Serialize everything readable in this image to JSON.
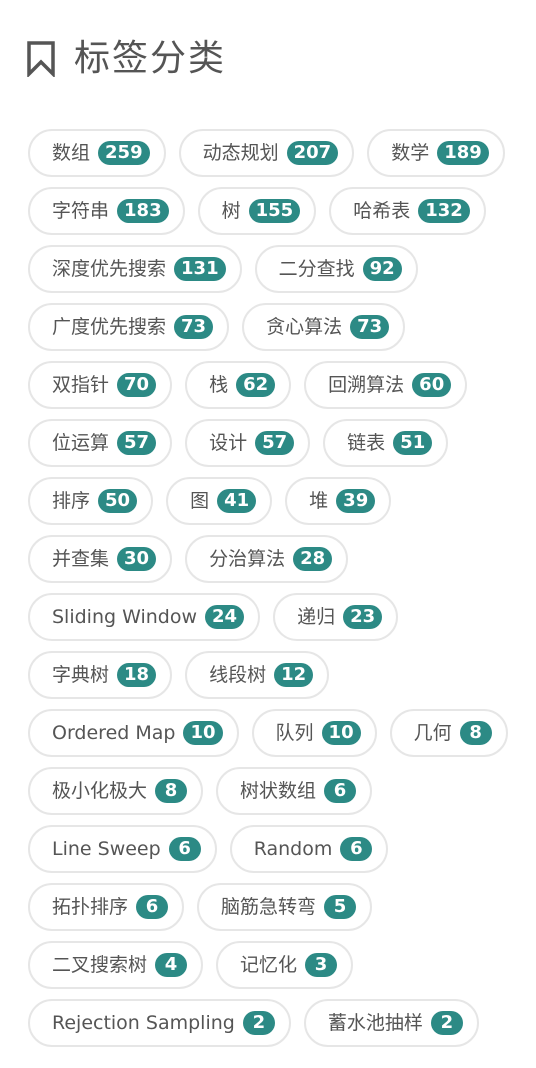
{
  "header": {
    "title": "标签分类",
    "icon": "bookmark-icon"
  },
  "colors": {
    "badge": "#2c8a85",
    "text": "#555555",
    "border": "#e6e6e6"
  },
  "tags": [
    {
      "label": "数组",
      "count": "259"
    },
    {
      "label": "动态规划",
      "count": "207"
    },
    {
      "label": "数学",
      "count": "189"
    },
    {
      "label": "字符串",
      "count": "183"
    },
    {
      "label": "树",
      "count": "155"
    },
    {
      "label": "哈希表",
      "count": "132"
    },
    {
      "label": "深度优先搜索",
      "count": "131"
    },
    {
      "label": "二分查找",
      "count": "92"
    },
    {
      "label": "广度优先搜索",
      "count": "73"
    },
    {
      "label": "贪心算法",
      "count": "73"
    },
    {
      "label": "双指针",
      "count": "70"
    },
    {
      "label": "栈",
      "count": "62"
    },
    {
      "label": "回溯算法",
      "count": "60"
    },
    {
      "label": "位运算",
      "count": "57"
    },
    {
      "label": "设计",
      "count": "57"
    },
    {
      "label": "链表",
      "count": "51"
    },
    {
      "label": "排序",
      "count": "50"
    },
    {
      "label": "图",
      "count": "41"
    },
    {
      "label": "堆",
      "count": "39"
    },
    {
      "label": "并查集",
      "count": "30"
    },
    {
      "label": "分治算法",
      "count": "28"
    },
    {
      "label": "Sliding Window",
      "count": "24"
    },
    {
      "label": "递归",
      "count": "23"
    },
    {
      "label": "字典树",
      "count": "18"
    },
    {
      "label": "线段树",
      "count": "12"
    },
    {
      "label": "Ordered Map",
      "count": "10"
    },
    {
      "label": "队列",
      "count": "10"
    },
    {
      "label": "几何",
      "count": "8"
    },
    {
      "label": "极小化极大",
      "count": "8"
    },
    {
      "label": "树状数组",
      "count": "6"
    },
    {
      "label": "Line Sweep",
      "count": "6"
    },
    {
      "label": "Random",
      "count": "6"
    },
    {
      "label": "拓扑排序",
      "count": "6"
    },
    {
      "label": "脑筋急转弯",
      "count": "5"
    },
    {
      "label": "二叉搜索树",
      "count": "4"
    },
    {
      "label": "记忆化",
      "count": "3"
    },
    {
      "label": "Rejection Sampling",
      "count": "2"
    },
    {
      "label": "蓄水池抽样",
      "count": "2"
    }
  ]
}
